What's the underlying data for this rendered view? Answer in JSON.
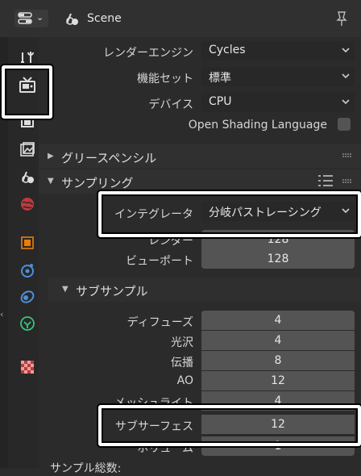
{
  "header": {
    "scene_title": "Scene",
    "editor_icon": "properties-editor-icon",
    "scene_icon": "scene-icon",
    "pin_icon": "pin-icon"
  },
  "tabs": [
    {
      "name": "tool-tab",
      "icon": "tool-icon"
    },
    {
      "name": "render-tab",
      "icon": "render-icon",
      "active": true
    },
    {
      "name": "output-tab",
      "icon": "output-icon"
    },
    {
      "name": "view-layer-tab",
      "icon": "view-layer-icon"
    },
    {
      "name": "scene-tab",
      "icon": "scene-icon"
    },
    {
      "name": "world-tab",
      "icon": "world-icon"
    },
    {
      "name": "object-tab",
      "icon": "object-icon"
    },
    {
      "name": "modifier-tab",
      "icon": "modifier-icon"
    },
    {
      "name": "physics-tab",
      "icon": "physics-icon"
    },
    {
      "name": "constraints-tab",
      "icon": "constraints-icon"
    },
    {
      "name": "texture-tab",
      "icon": "texture-icon"
    }
  ],
  "render": {
    "engine_label": "レンダーエンジン",
    "engine_value": "Cycles",
    "feature_label": "機能セット",
    "feature_value": "標準",
    "device_label": "デバイス",
    "device_value": "CPU",
    "osl_label": "Open Shading Language"
  },
  "panels": {
    "grease_pencil": "グリースペンシル",
    "sampling": "サンプリング",
    "subsample": "サブサンプル"
  },
  "sampling": {
    "integrator_label": "インテグレータ",
    "integrator_value": "分岐パストレーシング",
    "render_label": "レンダー",
    "render_value": "128",
    "viewport_label": "ビューポート",
    "viewport_value": "128"
  },
  "subsamples": [
    {
      "label": "ディフューズ",
      "value": "4"
    },
    {
      "label": "光沢",
      "value": "4"
    },
    {
      "label": "伝播",
      "value": "8"
    },
    {
      "label": "AO",
      "value": "12"
    },
    {
      "label": "メッシュライト",
      "value": "4"
    },
    {
      "label": "サブサーフェス",
      "value": "12"
    },
    {
      "label": "ボリューム",
      "value": "1"
    }
  ],
  "footer_label": "サンプル総数:",
  "colors": {
    "highlight": "#ffffff",
    "field": "#545454",
    "dropdown": "#282828",
    "accent": "#e87d0d"
  }
}
